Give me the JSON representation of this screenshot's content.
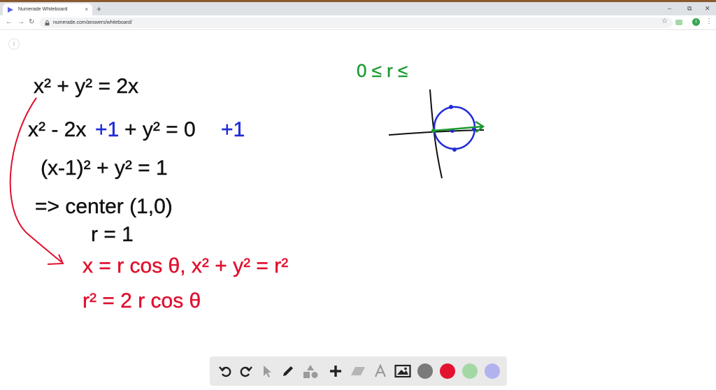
{
  "browser": {
    "tab_title": "Numerade Whiteboard",
    "tab_close": "×",
    "new_tab": "+",
    "url": "numerade.com/answers/whiteboard/",
    "avatar_letter": "I",
    "minimize": "–",
    "restore": "⧉",
    "close": "✕"
  },
  "whiteboard": {
    "info_icon": "i",
    "colors": {
      "ink_black": "#111111",
      "ink_blue": "#1f2bd6",
      "ink_red": "#e0102e",
      "ink_green": "#1a9a2e"
    },
    "lines": {
      "l1": "x² + y² = 2x",
      "l2_a": "x² - 2x",
      "l2_b": "+1",
      "l2_c": "+ y² = 0",
      "l2_d": "+1",
      "l3": "(x-1)² + y² = 1",
      "l4": "=> center (1,0)",
      "l5": "r = 1",
      "red1": "x = r cos θ, x² + y² = r²",
      "red2": "r² = 2 r cos θ",
      "green": "0 ≤ r ≤"
    }
  },
  "toolbar": {
    "tools": [
      "undo-icon",
      "redo-icon",
      "pointer-icon",
      "pen-icon",
      "shapes-icon",
      "plus-icon",
      "eraser-icon",
      "text-icon",
      "image-icon"
    ],
    "swatch_colors": [
      "#7a7a7a",
      "#e3132f",
      "#a3d8a5",
      "#b2b2ee"
    ]
  }
}
